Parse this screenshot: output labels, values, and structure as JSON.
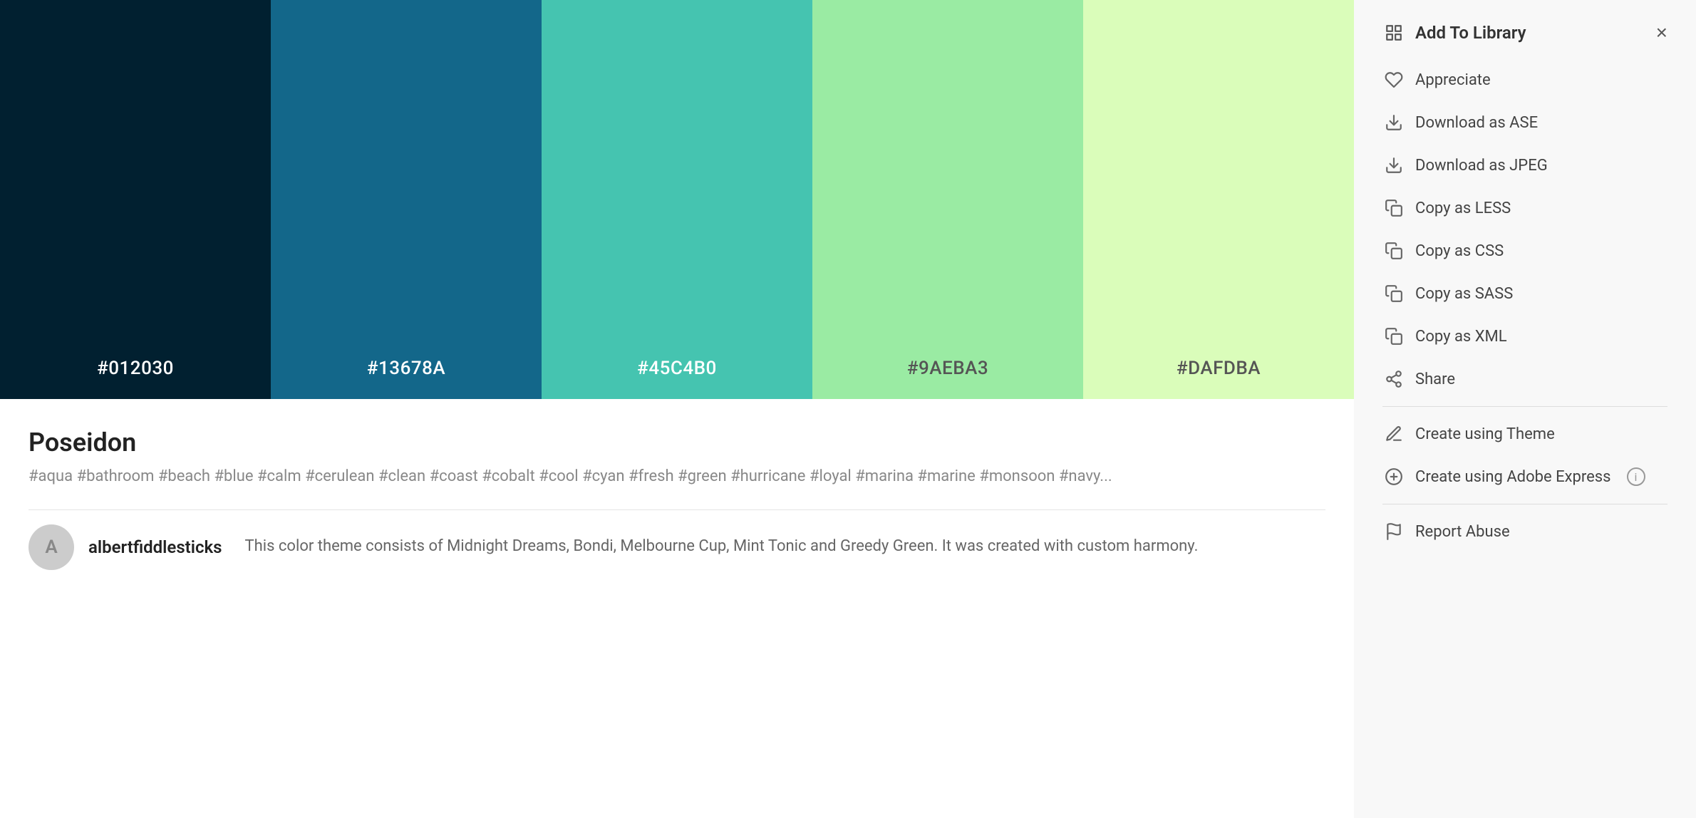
{
  "palette": {
    "title": "Poseidon",
    "tags": "#aqua #bathroom #beach #blue #calm #cerulean #clean #coast #cobalt #cool #cyan #fresh #green #hurricane #loyal #marina #marine #monsoon #navy...",
    "colors": [
      {
        "hex": "#012030",
        "label": "#012030",
        "dark_text": false
      },
      {
        "hex": "#13678A",
        "label": "#13678A",
        "dark_text": false
      },
      {
        "hex": "#45C4B0",
        "label": "#45C4B0",
        "dark_text": false
      },
      {
        "hex": "#9AEBA3",
        "label": "#9AEBA3",
        "dark_text": true
      },
      {
        "hex": "#DAFDBA",
        "label": "#DAFDBA",
        "dark_text": true
      }
    ]
  },
  "author": {
    "initial": "A",
    "name": "albertfiddlesticks",
    "description": "This color theme consists of Midnight Dreams, Bondi, Melbourne Cup, Mint Tonic and Greedy Green. It was created with custom harmony."
  },
  "sidebar": {
    "title": "Add To Library",
    "close_label": "×",
    "menu_items": [
      {
        "id": "appreciate",
        "label": "Appreciate",
        "icon": "heart"
      },
      {
        "id": "download-ase",
        "label": "Download as ASE",
        "icon": "download"
      },
      {
        "id": "download-jpeg",
        "label": "Download as JPEG",
        "icon": "download"
      },
      {
        "id": "copy-less",
        "label": "Copy as LESS",
        "icon": "copy"
      },
      {
        "id": "copy-css",
        "label": "Copy as CSS",
        "icon": "copy"
      },
      {
        "id": "copy-sass",
        "label": "Copy as SASS",
        "icon": "copy"
      },
      {
        "id": "copy-xml",
        "label": "Copy as XML",
        "icon": "copy"
      },
      {
        "id": "share",
        "label": "Share",
        "icon": "share"
      }
    ],
    "secondary_items": [
      {
        "id": "create-theme",
        "label": "Create using Theme",
        "icon": "brush"
      },
      {
        "id": "create-express",
        "label": "Create using Adobe Express",
        "icon": "circle",
        "has_info": true
      }
    ],
    "tertiary_items": [
      {
        "id": "report-abuse",
        "label": "Report Abuse",
        "icon": "flag"
      }
    ]
  }
}
